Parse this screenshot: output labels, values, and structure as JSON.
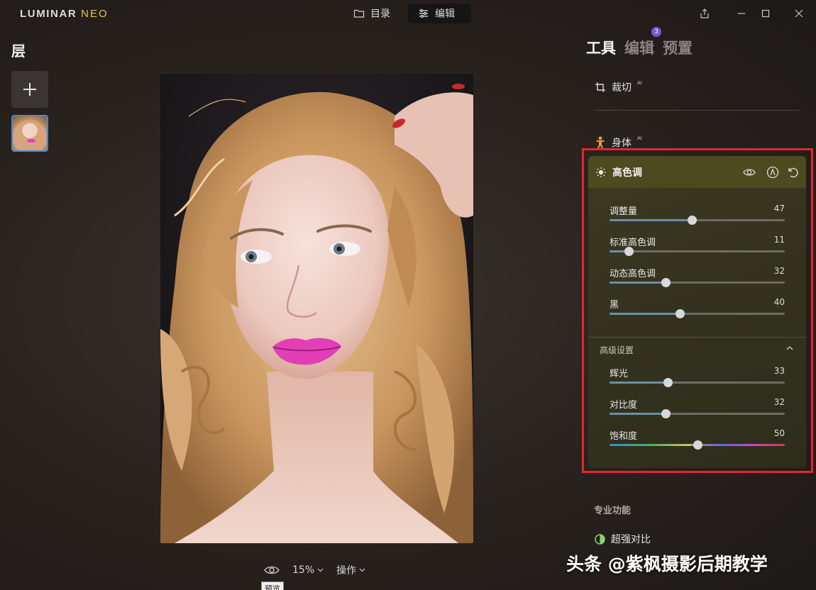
{
  "app": {
    "logo_main": "LUMINAR ",
    "logo_accent": "NEO"
  },
  "nav": {
    "catalog": "目录",
    "edit": "编辑"
  },
  "layers": {
    "title": "层"
  },
  "panel": {
    "tabs": [
      {
        "label": "工具"
      },
      {
        "label": "编辑",
        "badge": "3"
      },
      {
        "label": "预置"
      }
    ],
    "tools": {
      "crop": {
        "label": "裁切",
        "ai": "AI"
      },
      "body": {
        "label": "身体",
        "ai": "AI"
      }
    },
    "highkey": {
      "title": "高色调",
      "sliders": [
        {
          "label": "调整量",
          "value": "47",
          "pos": 0.47
        },
        {
          "label": "标准高色调",
          "value": "11",
          "pos": 0.11
        },
        {
          "label": "动态高色调",
          "value": "32",
          "pos": 0.32
        },
        {
          "label": "黑",
          "value": "40",
          "pos": 0.4
        }
      ],
      "advanced": {
        "title": "高级设置",
        "sliders": [
          {
            "label": "辉光",
            "value": "33",
            "pos": 0.33
          },
          {
            "label": "对比度",
            "value": "32",
            "pos": 0.32
          },
          {
            "label": "饱和度",
            "value": "50",
            "pos": 0.5
          }
        ]
      }
    },
    "pro_section": "专业功能",
    "supercontrast": "超强对比"
  },
  "bottom": {
    "zoom": "15%",
    "actions": "操作",
    "tooltip": "预览"
  },
  "watermark": "头条 @紫枫摄影后期教学",
  "colors": {
    "accent": "#4a86e0",
    "highlight_frame": "#e8242c",
    "badge": "#7d53d6"
  }
}
